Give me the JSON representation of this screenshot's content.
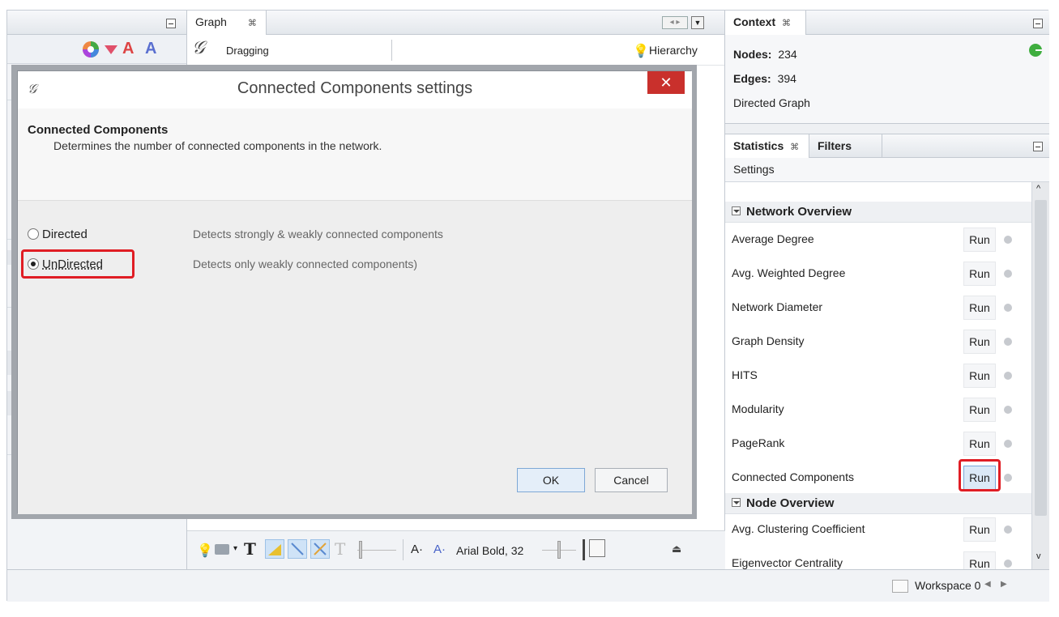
{
  "graph_panel": {
    "tab_label": "Graph",
    "toolbar_mode": "Dragging",
    "hierarchy_label": "Hierarchy",
    "font_label": "Arial Bold, 32",
    "text_size_down": "A·",
    "text_size_up": "A·"
  },
  "context": {
    "tab_label": "Context",
    "nodes_label": "Nodes:",
    "nodes_value": "234",
    "edges_label": "Edges:",
    "edges_value": "394",
    "graph_type": "Directed Graph"
  },
  "statistics": {
    "tab_label": "Statistics",
    "filters_tab_label": "Filters",
    "settings_label": "Settings",
    "run_label": "Run",
    "sections": [
      {
        "title": "Network Overview",
        "items": [
          "Average Degree",
          "Avg. Weighted Degree",
          "Network Diameter",
          "Graph Density",
          "HITS",
          "Modularity",
          "PageRank",
          "Connected Components"
        ]
      },
      {
        "title": "Node Overview",
        "items": [
          "Avg. Clustering Coefficient",
          "Eigenvector Centrality"
        ]
      }
    ]
  },
  "dialog": {
    "title": "Connected Components settings",
    "close_glyph": "✕",
    "header_title": "Connected Components",
    "header_desc": "Determines the number of connected components in the network.",
    "options": [
      {
        "label": "Directed",
        "desc": "Detects strongly & weakly connected components",
        "selected": false
      },
      {
        "label": "UnDirected",
        "desc": "Detects only weakly connected components)",
        "selected": true
      }
    ],
    "ok_label": "OK",
    "cancel_label": "Cancel"
  },
  "status_bar": {
    "workspace_label": "Workspace 0"
  },
  "colors": {
    "highlight": "#e01d24",
    "close_button": "#c9302c",
    "status_green": "#3fae3f"
  }
}
